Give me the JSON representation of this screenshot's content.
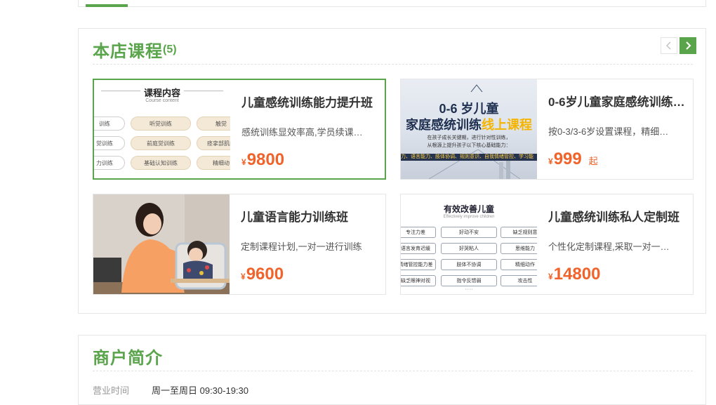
{
  "courses_section": {
    "title": "本店课程",
    "count": "(5)",
    "prev_icon": "chevron-left-icon",
    "next_icon": "chevron-right-icon",
    "accent_color": "#5aa44b",
    "price_color": "#f0632b"
  },
  "courses": [
    {
      "title": "儿童感统训练能力提升班",
      "desc": "感统训练显效率高,学员续课…",
      "currency": "¥",
      "price": "9800",
      "price_suffix": "",
      "thumb": {
        "heading": "课程内容",
        "subheading": "Course content",
        "pills": [
          "训练",
          "听觉训练",
          "触觉",
          "觉训练",
          "前庭觉训练",
          "痉挛部肌肉",
          "力训练",
          "基础认知训练",
          "精细动"
        ]
      }
    },
    {
      "title": "0-6岁儿童家庭感统训练…",
      "desc": "按0-3/3-6岁设置课程，精细…",
      "currency": "¥",
      "price": "999",
      "price_suffix": "起",
      "thumb": {
        "line1": "0-6 岁儿童",
        "line2_a": "家庭感统训练",
        "line2_b": "线上课程",
        "sub1": "在孩子成长关键期，进行针对性训练，",
        "sub2": "从根源上提升孩子以下核心基础能力：",
        "band": "力、语言能力、肢体协调、规则意识、自我情绪管控、学习能"
      }
    },
    {
      "title": "儿童语言能力训练班",
      "desc": "定制课程计划,一对一进行训练",
      "currency": "¥",
      "price": "9600",
      "price_suffix": ""
    },
    {
      "title": "儿童感统训练私人定制班",
      "desc": "个性化定制课程,采取一对一…",
      "currency": "¥",
      "price": "14800",
      "price_suffix": "",
      "thumb": {
        "heading": "有效改善儿童",
        "subheading": "Effectively improve children",
        "boxes": [
          "专注力差",
          "好动不安",
          "缺乏规则意",
          "语言发育迟缓",
          "好哭粘人",
          "思维能力",
          "情绪管控能力差",
          "肢体不协调",
          "精细动作",
          "缺乏眼神对视",
          "指令反馈弱",
          "攻击性"
        ],
        "more": "·····"
      }
    }
  ],
  "intro_section": {
    "title": "商户简介",
    "hours_label": "营业时间",
    "hours_value": "周一至周日 09:30-19:30"
  }
}
